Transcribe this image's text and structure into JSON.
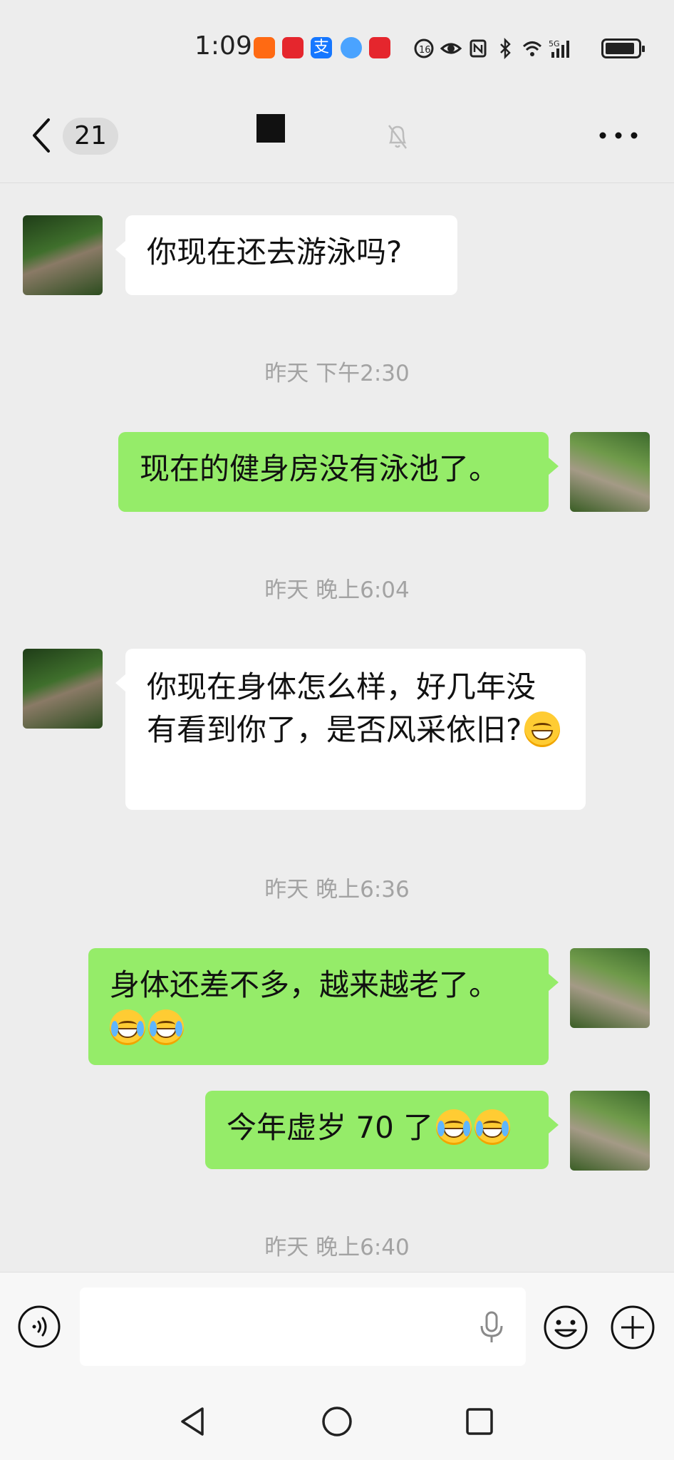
{
  "status_bar": {
    "time": "1:09",
    "notification_icons": [
      "app-icon-orange",
      "app-icon-red",
      "alipay-icon",
      "browser-icon",
      "app-icon-red"
    ],
    "system_icons": [
      "hd-icon",
      "eye-icon",
      "nfc-icon",
      "bluetooth-icon",
      "wifi-icon",
      "signal-5g-icon",
      "battery-icon"
    ]
  },
  "header": {
    "unread_count": "21",
    "mute_icon": "bell-muted-icon",
    "more_icon": "more-dots-icon"
  },
  "messages": [
    {
      "side": "left",
      "text": "你现在还去游泳吗?"
    },
    {
      "timestamp": "昨天 下午2:30"
    },
    {
      "side": "right",
      "text": "现在的健身房没有泳池了。"
    },
    {
      "timestamp": "昨天 晚上6:04"
    },
    {
      "side": "left",
      "text": "你现在身体怎么样，好几年没有看到你了，是否风采依旧?",
      "emoji": "grin-emoji"
    },
    {
      "timestamp": "昨天 晚上6:36"
    },
    {
      "side": "right",
      "text": "身体还差不多，越来越老了。",
      "emoji": "laugh-cry-emoji x2"
    },
    {
      "side": "right",
      "text": "今年虚岁 70 了",
      "emoji": "laugh-cry-emoji x2"
    },
    {
      "timestamp": "昨天 晚上6:40"
    }
  ],
  "input_bar": {
    "voice_icon": "voice-mode-icon",
    "mic_icon": "mic-icon",
    "emoji_icon": "emoji-icon",
    "plus_icon": "plus-icon"
  },
  "colors": {
    "bubble_self": "#95ec69",
    "bubble_other": "#ffffff",
    "background": "#ededed"
  }
}
